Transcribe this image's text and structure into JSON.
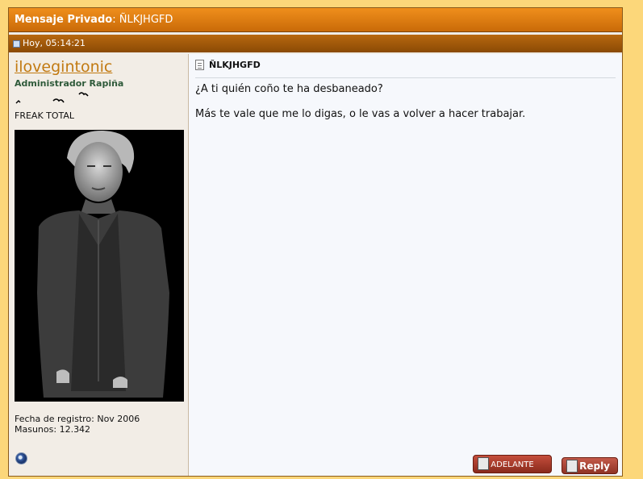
{
  "header": {
    "title_label": "Mensaje Privado",
    "title_sep": ":",
    "title_subject": "ÑLKJHGFD"
  },
  "date_bar": {
    "date": "Hoy, 05:14:21"
  },
  "user": {
    "username": "ilovegintonic",
    "title": "Administrador Rapiña",
    "rank": "FREAK TOTAL",
    "join_date": "Fecha de registro: Nov 2006",
    "posts": "Masunos: 12.342"
  },
  "message": {
    "title": "ÑLKJHGFD",
    "lines": [
      "¿A ti quién coño te ha desbaneado?",
      "Más te vale que me lo digas, o le vas a volver a hacer trabajar."
    ]
  },
  "buttons": {
    "forward": "ADELANTE",
    "reply": "Reply"
  },
  "colors": {
    "accent": "#e07f10",
    "background": "#fcd77a",
    "username": "#c27a12"
  }
}
